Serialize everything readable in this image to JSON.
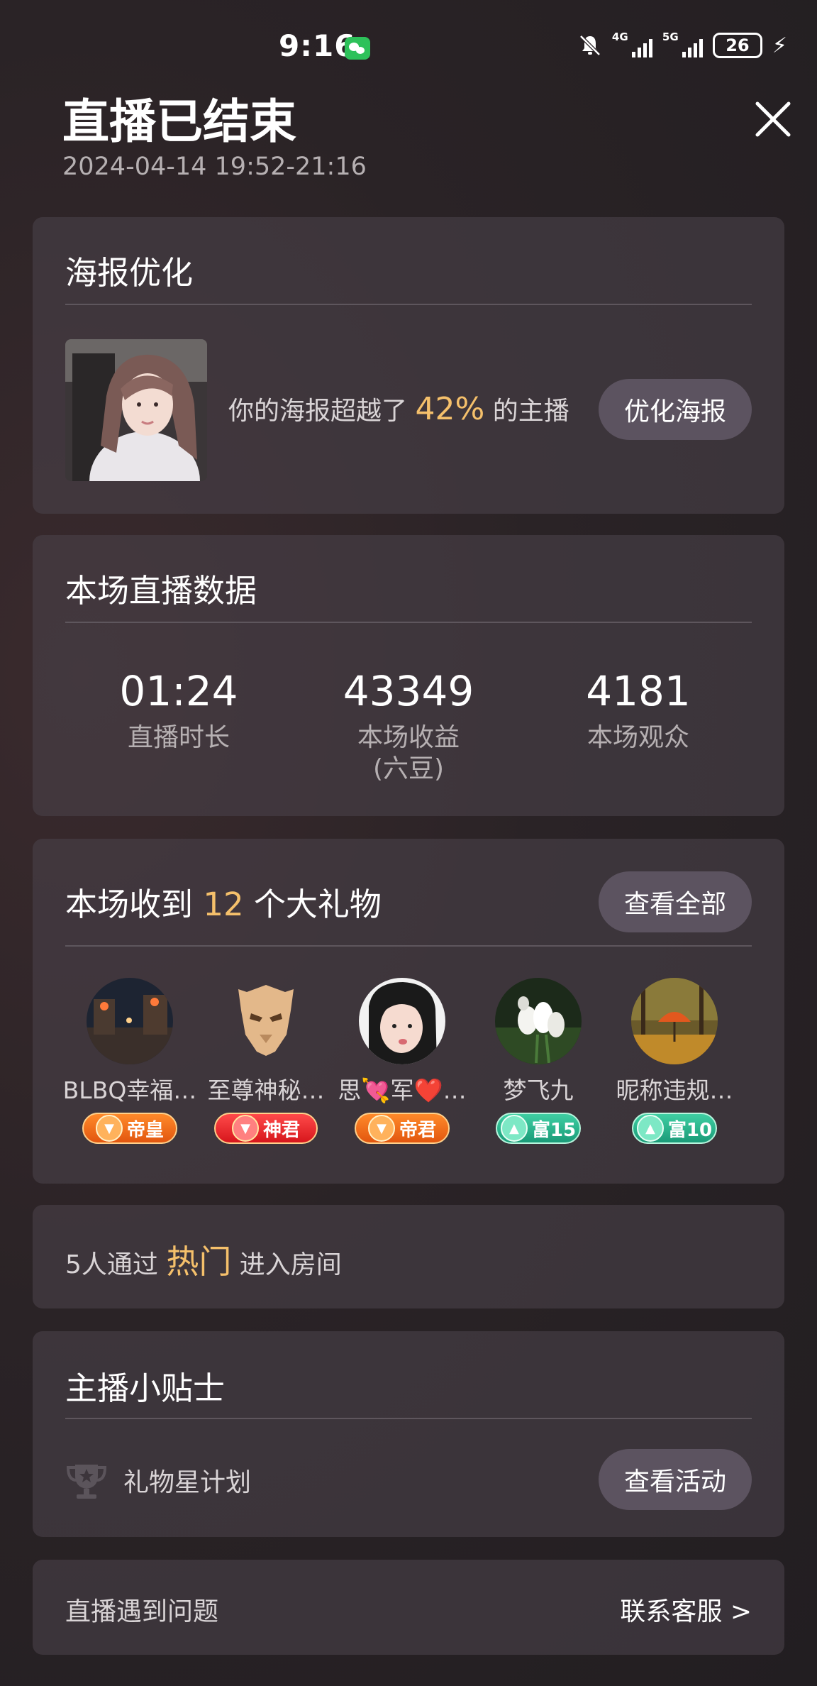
{
  "status_bar": {
    "time": "9:16",
    "network_1": "4G",
    "network_2": "5G",
    "battery": "26"
  },
  "header": {
    "title": "直播已结束",
    "time_range": "2024-04-14 19:52-21:16"
  },
  "poster": {
    "title": "海报优化",
    "text_before": "你的海报超越了 ",
    "percent": "42%",
    "text_after": " 的主播",
    "button": "优化海报"
  },
  "live_data": {
    "title": "本场直播数据",
    "stats": [
      {
        "value": "01:24",
        "label": "直播时长"
      },
      {
        "value": "43349",
        "label": "本场收益\n(六豆)"
      },
      {
        "value": "4181",
        "label": "本场观众"
      }
    ]
  },
  "gifts": {
    "title_before": "本场收到 ",
    "count": "12",
    "title_after": " 个大礼物",
    "button": "查看全部",
    "givers": [
      {
        "name": "BLBQ幸福…",
        "badge": "帝皇",
        "badge_style": "orange"
      },
      {
        "name": "至尊神秘…",
        "badge": "神君",
        "badge_style": "red"
      },
      {
        "name": "思💘军❤️…",
        "badge": "帝君",
        "badge_style": "orange"
      },
      {
        "name": "梦飞九",
        "badge": "富15",
        "badge_style": "green"
      },
      {
        "name": "昵称违规…",
        "badge": "富10",
        "badge_style": "green"
      }
    ]
  },
  "hot": {
    "text_before": "5人通过 ",
    "highlight": "热门",
    "text_after": " 进入房间"
  },
  "tips": {
    "title": "主播小贴士",
    "item_label": "礼物星计划",
    "button": "查看活动"
  },
  "problem": {
    "text": "直播遇到问题",
    "link": "联系客服 >"
  },
  "colors": {
    "accent": "#f5c06b",
    "pill_bg": "#5c5360",
    "card_bg": "#3f383f"
  }
}
